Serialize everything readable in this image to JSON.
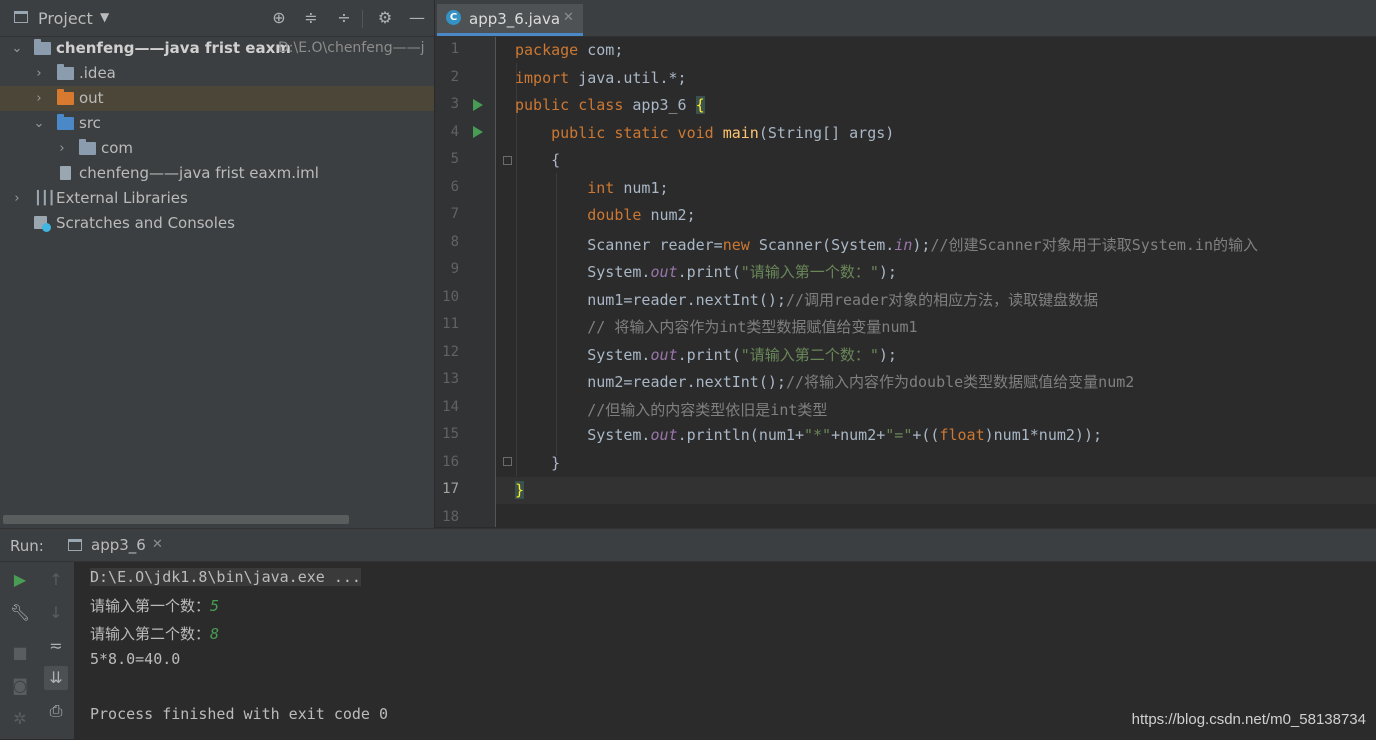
{
  "project_panel": {
    "title": "Project",
    "toolbar_icons": [
      "locate-icon",
      "expand-all-icon",
      "collapse-all-icon",
      "gear-icon",
      "minimize-icon"
    ],
    "tree": [
      {
        "label": "chenfeng——java frist eaxm",
        "path": "D:\\E.O\\chenfeng——j",
        "type": "module",
        "expanded": true
      },
      {
        "label": ".idea",
        "type": "folder",
        "color": "#8b9cae"
      },
      {
        "label": "out",
        "type": "folder",
        "color": "#d7792e",
        "selected": true
      },
      {
        "label": "src",
        "type": "folder",
        "color": "#4a88c7",
        "expanded": true
      },
      {
        "label": "com",
        "type": "package"
      },
      {
        "label": "chenfeng——java frist eaxm.iml",
        "type": "file"
      },
      {
        "label": "External Libraries",
        "type": "library"
      },
      {
        "label": "Scratches and Consoles",
        "type": "scratches"
      }
    ]
  },
  "editor": {
    "tab_label": "app3_6.java",
    "current_line": 17,
    "line_numbers": [
      "1",
      "2",
      "3",
      "4",
      "5",
      "6",
      "7",
      "8",
      "9",
      "10",
      "11",
      "12",
      "13",
      "14",
      "15",
      "16",
      "17",
      "18"
    ],
    "code": {
      "l1_kw": "package",
      "l1_rest": " com;",
      "l2_kw": "import",
      "l2_rest": " java.util.*;",
      "l3_kw": "public class",
      "l3_name": " app3_6 ",
      "l3_brace": "{",
      "l4_kw": "    public static void ",
      "l4_fn": "main",
      "l4_rest": "(String[] args)",
      "l5": "    {",
      "l6_kw": "        int",
      "l6_rest": " num1;",
      "l7_kw": "        double",
      "l7_rest": " num2;",
      "l8_a": "        Scanner reader=",
      "l8_kw": "new",
      "l8_b": " Scanner(System.",
      "l8_st": "in",
      "l8_c": ");",
      "l8_cm": "//创建Scanner对象用于读取System.in的输入",
      "l9_a": "        System.",
      "l9_st": "out",
      "l9_b": ".print(",
      "l9_str": "\"请输入第一个数：\"",
      "l9_c": ");",
      "l10_a": "        num1=reader.nextInt();",
      "l10_cm": "//调用reader对象的相应方法，读取键盘数据",
      "l11_cm": "        // 将输入内容作为int类型数据赋值给变量num1",
      "l12_a": "        System.",
      "l12_st": "out",
      "l12_b": ".print(",
      "l12_str": "\"请输入第二个数：\"",
      "l12_c": ");",
      "l13_a": "        num2=reader.nextInt();",
      "l13_cm": "//将输入内容作为double类型数据赋值给变量num2",
      "l14_cm": "        //但输入的内容类型依旧是int类型",
      "l15_a": "        System.",
      "l15_st": "out",
      "l15_b": ".println(num1+",
      "l15_str1": "\"*\"",
      "l15_c": "+num2+",
      "l15_str2": "\"=\"",
      "l15_d": "+((",
      "l15_kw": "float",
      "l15_e": ")num1*num2));",
      "l16": "    }",
      "l17": "}"
    }
  },
  "run_panel": {
    "label": "Run:",
    "tab_label": "app3_6",
    "console": {
      "cmd": "D:\\E.O\\jdk1.8\\bin\\java.exe ...",
      "prompt1": "请输入第一个数：",
      "input1": "5",
      "prompt2": "请输入第二个数：",
      "input2": "8",
      "result": "5*8.0=40.0",
      "finished": "Process finished with exit code 0"
    }
  },
  "watermark": "https://blog.csdn.net/m0_58138734"
}
